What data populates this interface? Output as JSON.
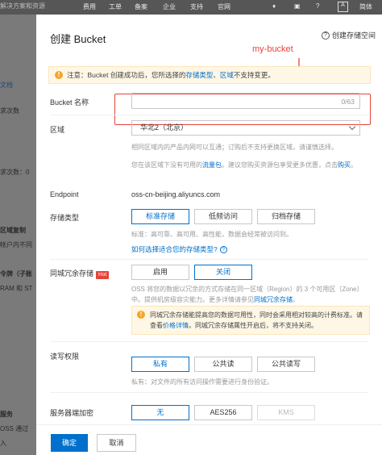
{
  "console": {
    "search_placeholder": "解决方案和资源",
    "nav": [
      "费用",
      "工单",
      "备案",
      "企业",
      "支持",
      "官网"
    ],
    "lang": "简体",
    "side": [
      "文档",
      "求次数",
      "求次数：0",
      "区域复制",
      "帐户内不同",
      "令牌（子账",
      "RAM 和 ST",
      "服务",
      "OSS 通过",
      "入"
    ]
  },
  "drawer": {
    "title": "创建 Bucket",
    "help_label": "创建存储空间",
    "annotation": "my-bucket",
    "notice": {
      "prefix": "注意：Bucket 创建成功后，您所选择的",
      "link1": "存储类型",
      "sep": "、",
      "link2": "区域",
      "suffix": "不支持变更。"
    },
    "bucket_name": {
      "label": "Bucket 名称",
      "value": "",
      "counter": "0/63"
    },
    "region": {
      "label": "区域",
      "selected": "华北2（北京）",
      "hint1": "相同区域内的产品内网可以互通；订购后不支持更换区域，请谨慎选择。",
      "hint2_prefix": "您在该区域下没有可用的",
      "hint2_link": "流量包",
      "hint2_suffix": "。建议您购买资源包享受更多优惠，点击",
      "hint2_link2": "购买",
      "hint2_end": "。"
    },
    "endpoint": {
      "label": "Endpoint",
      "value": "oss-cn-beijing.aliyuncs.com"
    },
    "storage_class": {
      "label": "存储类型",
      "options": [
        "标准存储",
        "低频访问",
        "归档存储"
      ],
      "selected": "标准存储",
      "hint": "标准：高可靠、高可用、高性能，数据会经常被访问到。",
      "help_link": "如何选择适合您的存储类型?"
    },
    "redundancy": {
      "label": "同城冗余存储",
      "hot": "Hot",
      "options": [
        "启用",
        "关闭"
      ],
      "selected": "关闭",
      "hint_prefix": "OSS 将您的数据以冗余的方式存储在同一区域（Region）的 3 个可用区（Zone）中。提供机房级容灾能力。更多详情请参见",
      "hint_link": "同城冗余存储",
      "hint_end": "。",
      "warn_prefix": "同城冗余存储能提高您的数据可用性，同时会采用相对较高的计费标准。请查看",
      "warn_link": "价格详情",
      "warn_suffix": "。同城冗余存储属性开启后，将不支持关闭。"
    },
    "acl": {
      "label": "读写权限",
      "options": [
        "私有",
        "公共读",
        "公共读写"
      ],
      "selected": "私有",
      "hint": "私有：对文件的所有访问操作需要进行身份验证。"
    },
    "encryption": {
      "label": "服务器端加密",
      "options": [
        "无",
        "AES256",
        "KMS"
      ],
      "selected": "无"
    },
    "footer": {
      "ok": "确定",
      "cancel": "取消"
    }
  },
  "colors": {
    "accent": "#0070cc",
    "annotation": "#e5443a",
    "warning": "#f5a623"
  }
}
